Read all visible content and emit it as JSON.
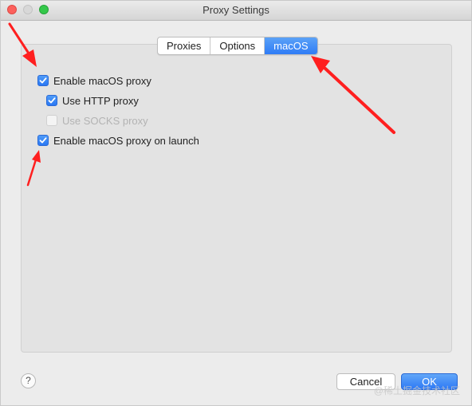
{
  "window": {
    "title": "Proxy Settings"
  },
  "tabs": [
    {
      "label": "Proxies",
      "selected": false
    },
    {
      "label": "Options",
      "selected": false
    },
    {
      "label": "macOS",
      "selected": true
    }
  ],
  "options": [
    {
      "label": "Enable macOS proxy",
      "checked": true,
      "enabled": true
    },
    {
      "label": "Use HTTP proxy",
      "checked": true,
      "enabled": true
    },
    {
      "label": "Use SOCKS proxy",
      "checked": false,
      "enabled": false
    },
    {
      "label": "Enable macOS proxy on launch",
      "checked": true,
      "enabled": true
    }
  ],
  "buttons": {
    "help": "?",
    "cancel": "Cancel",
    "ok": "OK"
  },
  "watermark": "@稀土掘金技术社区",
  "colors": {
    "accent": "#2f7cf6",
    "annotation_arrow": "#ff1f1f"
  }
}
